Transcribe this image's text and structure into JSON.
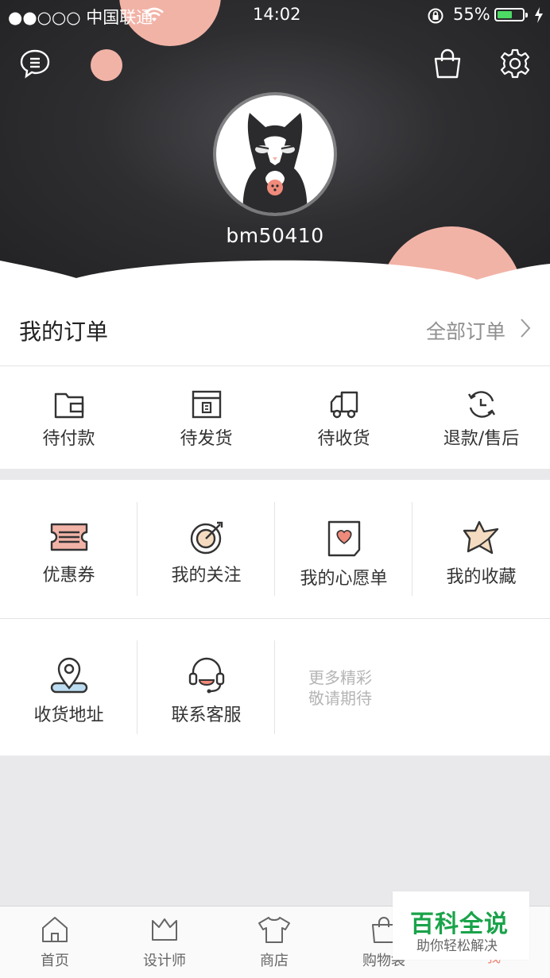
{
  "status_bar": {
    "carrier": "●●○○○ 中国联通",
    "time": "14:02",
    "battery": "55%"
  },
  "profile": {
    "username": "bm50410"
  },
  "orders": {
    "title": "我的订单",
    "all_label": "全部订单",
    "items": [
      {
        "label": "待付款",
        "icon": "wallet-icon"
      },
      {
        "label": "待发货",
        "icon": "package-icon"
      },
      {
        "label": "待收货",
        "icon": "truck-icon"
      },
      {
        "label": "退款/售后",
        "icon": "refund-icon"
      }
    ]
  },
  "services": {
    "row1": [
      {
        "label": "优惠券",
        "icon": "coupon-icon"
      },
      {
        "label": "我的关注",
        "icon": "target-icon"
      },
      {
        "label": "我的心愿单",
        "icon": "wishlist-icon"
      },
      {
        "label": "我的收藏",
        "icon": "star-icon"
      }
    ],
    "row2": [
      {
        "label": "收货地址",
        "icon": "location-icon"
      },
      {
        "label": "联系客服",
        "icon": "headset-icon"
      }
    ],
    "more_line1": "更多精彩",
    "more_line2": "敬请期待"
  },
  "tabbar": [
    {
      "label": "首页",
      "icon": "home-icon"
    },
    {
      "label": "设计师",
      "icon": "crown-icon"
    },
    {
      "label": "商店",
      "icon": "tshirt-icon"
    },
    {
      "label": "购物袋",
      "icon": "bag-icon"
    },
    {
      "label": "我",
      "icon": "me-icon"
    }
  ],
  "watermark": {
    "title": "百科全说",
    "subtitle": "助你轻松解决"
  },
  "colors": {
    "accent": "#f08a7a",
    "header_dark": "#2e2e31",
    "bubble": "#f2b3a7",
    "watermark_green": "#1aa34a"
  }
}
